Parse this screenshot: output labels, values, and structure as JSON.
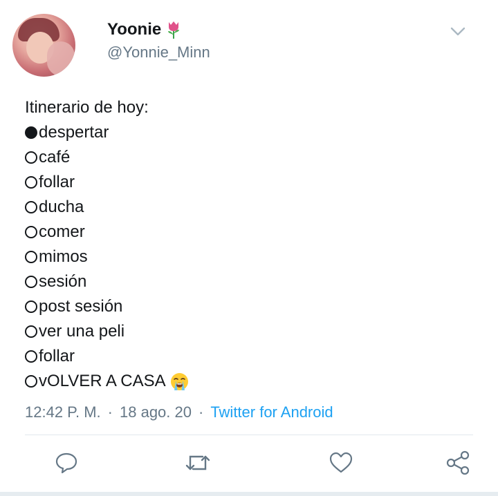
{
  "tweet": {
    "author_name": "Yoonie",
    "author_emoji_icon": "tulip-icon",
    "handle": "@Yonnie_Minn",
    "lines": [
      {
        "bullet": "filled",
        "text": "despertar"
      },
      {
        "bullet": "empty",
        "text": "café"
      },
      {
        "bullet": "empty",
        "text": "follar"
      },
      {
        "bullet": "empty",
        "text": "ducha"
      },
      {
        "bullet": "empty",
        "text": "comer"
      },
      {
        "bullet": "empty",
        "text": "mimos"
      },
      {
        "bullet": "empty",
        "text": "sesión"
      },
      {
        "bullet": "empty",
        "text": "post sesión"
      },
      {
        "bullet": "empty",
        "text": "ver una peli"
      },
      {
        "bullet": "empty",
        "text": "follar"
      },
      {
        "bullet": "empty",
        "text": "vOLVER A CASA"
      }
    ],
    "intro": "Itinerario de hoy:",
    "last_line_emoji_icon": "loudly-crying-face-icon",
    "time": "12:42 P. M.",
    "date": "18 ago. 20",
    "separator": "·",
    "source": "Twitter for Android"
  },
  "actions": {
    "reply_icon": "reply-icon",
    "retweet_icon": "retweet-icon",
    "like_icon": "heart-icon",
    "share_icon": "share-icon"
  },
  "colors": {
    "text": "#14171a",
    "secondary": "#657786",
    "link": "#1da1f2",
    "divider": "#e1e8ed"
  }
}
